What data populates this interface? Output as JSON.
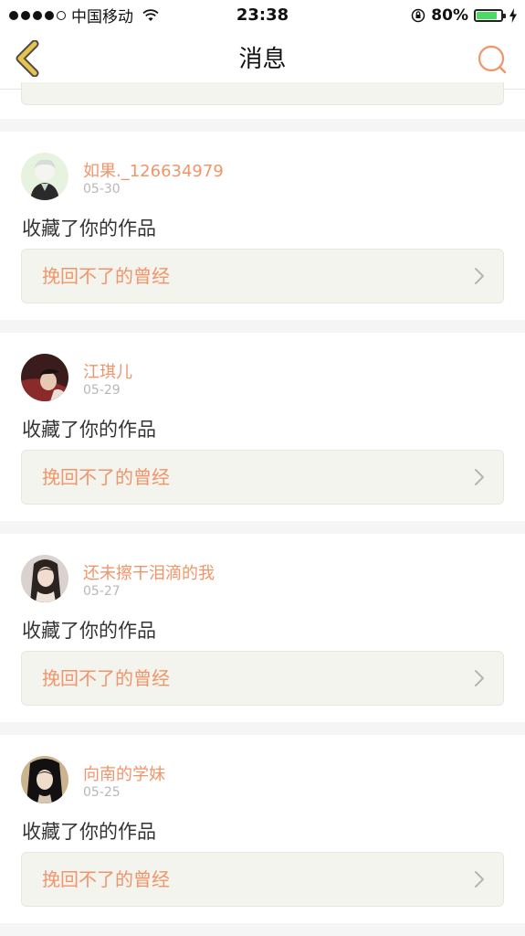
{
  "status_bar": {
    "carrier": "中国移动",
    "time": "23:38",
    "battery_percent": "80%",
    "battery_level": 0.8,
    "signal_bars_filled": 4,
    "signal_bars_total": 5
  },
  "nav": {
    "title": "消息",
    "back_icon": "chevron-left-icon",
    "search_icon": "search-icon"
  },
  "colors": {
    "accent": "#f0956a",
    "back_arrow": "#e8b830",
    "text": "#333333",
    "muted": "#b8b8b8",
    "ref_bg": "#f4f4ee"
  },
  "messages": [
    {
      "username": "如果._126634979",
      "date": "05-30",
      "action": "收藏了你的作品",
      "work_title": "挽回不了的曾经"
    },
    {
      "username": "江琪儿",
      "date": "05-29",
      "action": "收藏了你的作品",
      "work_title": "挽回不了的曾经"
    },
    {
      "username": "还未擦干泪滴的我",
      "date": "05-27",
      "action": "收藏了你的作品",
      "work_title": "挽回不了的曾经"
    },
    {
      "username": "向南的学妹",
      "date": "05-25",
      "action": "收藏了你的作品",
      "work_title": "挽回不了的曾经"
    }
  ]
}
